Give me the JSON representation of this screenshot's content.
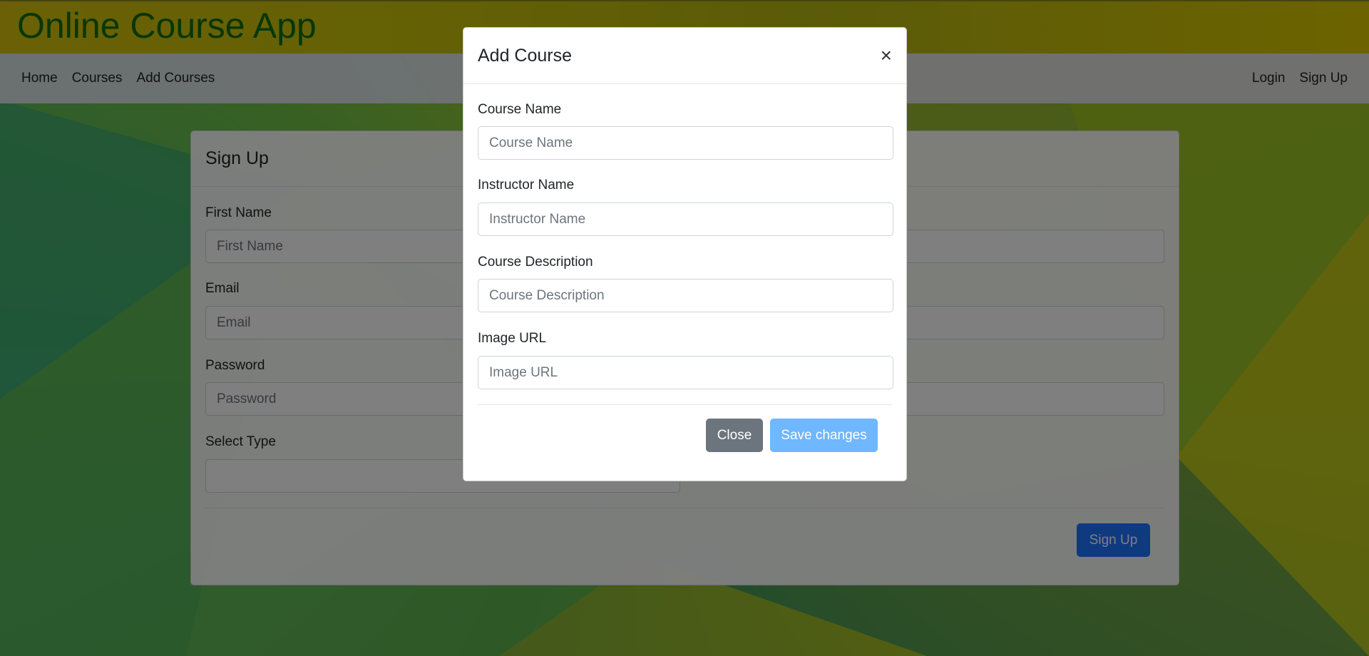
{
  "app": {
    "title": "Online Course App"
  },
  "nav": {
    "left": [
      "Home",
      "Courses",
      "Add Courses"
    ],
    "right": [
      "Login",
      "Sign Up"
    ]
  },
  "signup_card": {
    "title": "Sign Up",
    "fields": {
      "first_name": {
        "label": "First Name",
        "placeholder": "First Name"
      },
      "email": {
        "label": "Email",
        "placeholder": "Email"
      },
      "password": {
        "label": "Password",
        "placeholder": "Password"
      },
      "select_type": {
        "label": "Select Type",
        "value": ""
      }
    },
    "submit_label": "Sign Up"
  },
  "modal": {
    "title": "Add Course",
    "close_icon": "×",
    "fields": {
      "course_name": {
        "label": "Course Name",
        "placeholder": "Course Name"
      },
      "instructor_name": {
        "label": "Instructor Name",
        "placeholder": "Instructor Name"
      },
      "course_description": {
        "label": "Course Description",
        "placeholder": "Course Description"
      },
      "image_url": {
        "label": "Image URL",
        "placeholder": "Image URL"
      }
    },
    "close_label": "Close",
    "save_label": "Save changes"
  },
  "colors": {
    "brand_title": "#0f6e0f",
    "primary": "#1e74ff",
    "secondary": "#6c757d"
  }
}
